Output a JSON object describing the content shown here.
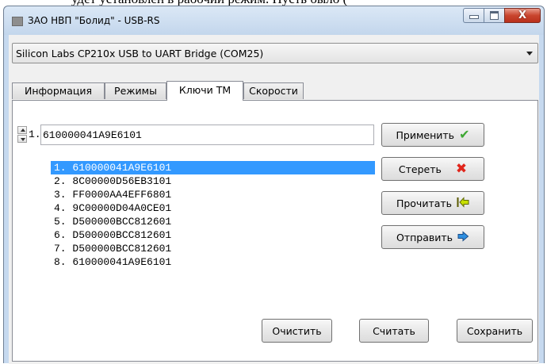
{
  "background_text": "удет установлен в рабочий режим.  Пусть было (",
  "window": {
    "title": "ЗАО НВП \"Болид\" - USB-RS",
    "close_label": "X"
  },
  "device_select": {
    "value": "Silicon Labs CP210x USB to UART Bridge (COM25)"
  },
  "tabs": [
    {
      "label": "Информация",
      "active": false
    },
    {
      "label": "Режимы",
      "active": false
    },
    {
      "label": "Ключи ТМ",
      "active": true
    },
    {
      "label": "Скорости",
      "active": false
    }
  ],
  "key_editor": {
    "index_label": "1.",
    "value": "610000041A9E6101"
  },
  "keys": [
    "1. 610000041A9E6101",
    "2. 8C00000D56EB3101",
    "3. FF0000AA4EFF6801",
    "4. 9C00000D04A0CE01",
    "5. D500000BCC812601",
    "6. D500000BCC812601",
    "7. D500000BCC812601",
    "8. 610000041A9E6101"
  ],
  "selected_key_index": 0,
  "buttons": {
    "apply": "Применить",
    "erase": "Стереть",
    "read": "Прочитать",
    "send": "Отправить",
    "clear": "Очистить",
    "count": "Считать",
    "save": "Сохранить"
  },
  "colors": {
    "selection": "#3399ff",
    "check": "#3fa833",
    "cross": "#e0251b",
    "read_icon": "#c8e000",
    "send_icon": "#2e8fe0"
  }
}
